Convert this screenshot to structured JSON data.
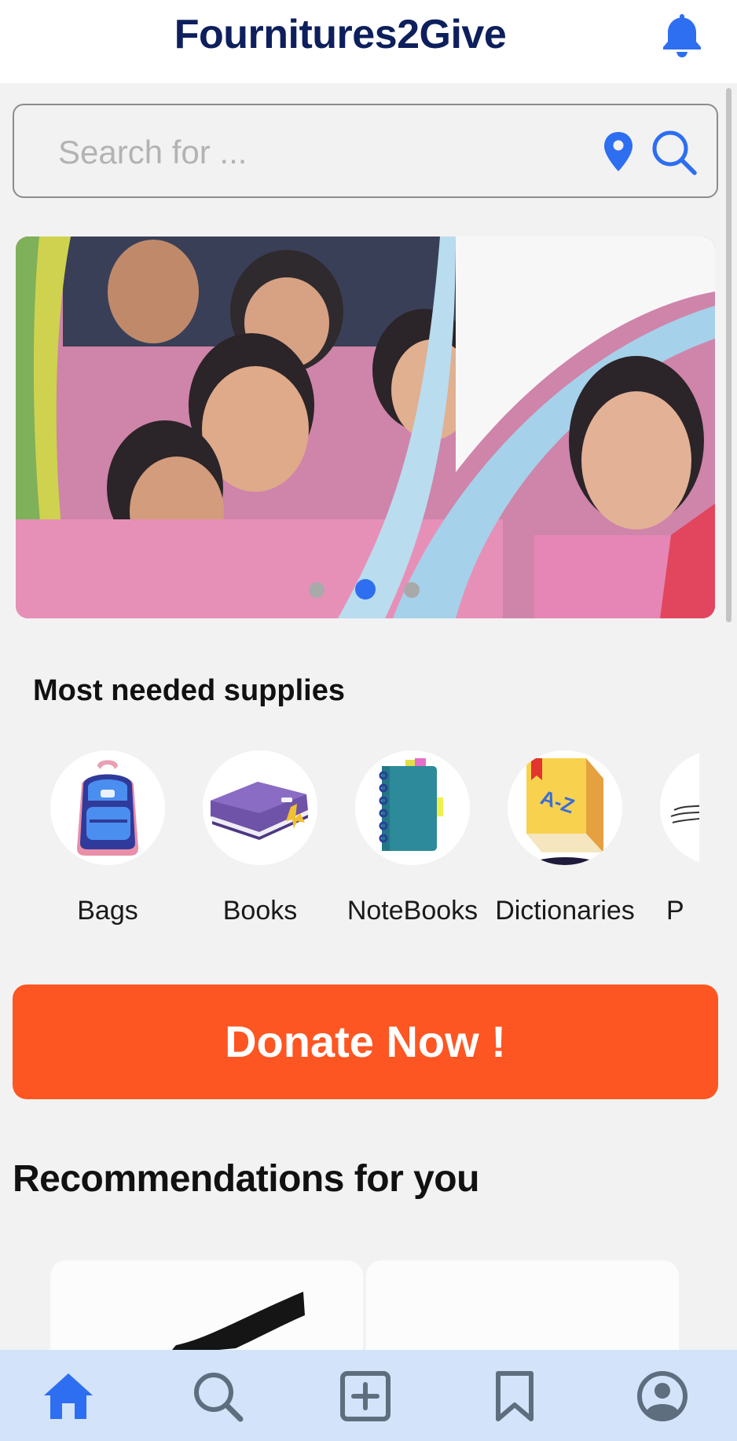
{
  "header": {
    "title": "Fournitures2Give",
    "notification_icon": "bell-icon"
  },
  "search": {
    "placeholder": "Search for ...",
    "location_icon": "map-pin-icon",
    "search_icon": "search-icon"
  },
  "banner": {
    "image": "children-group-photo",
    "slide_count": 3,
    "active_slide": 2
  },
  "supplies": {
    "title": "Most needed supplies",
    "items": [
      {
        "label": "Bags",
        "icon": "backpack-icon"
      },
      {
        "label": "Books",
        "icon": "book-icon"
      },
      {
        "label": "NoteBooks",
        "icon": "notebook-icon"
      },
      {
        "label": "Dictionaries",
        "icon": "dictionary-icon"
      },
      {
        "label": "P",
        "icon": "pencil-icon"
      }
    ]
  },
  "donate": {
    "label": "Donate Now !"
  },
  "recommendations": {
    "title": "Recommendations for you",
    "card_count": 2
  },
  "tabbar": {
    "items": [
      {
        "name": "home",
        "icon": "home-icon",
        "active": true
      },
      {
        "name": "search",
        "icon": "search-icon",
        "active": false
      },
      {
        "name": "add",
        "icon": "add-square-icon",
        "active": false
      },
      {
        "name": "saved",
        "icon": "bookmark-icon",
        "active": false
      },
      {
        "name": "profile",
        "icon": "profile-icon",
        "active": false
      }
    ]
  },
  "colors": {
    "primary": "#2e6ef0",
    "title": "#0d1f5c",
    "donate": "#fd5622",
    "tabbar": "#d3e3f9",
    "tab_inactive": "#5e6e7e"
  }
}
